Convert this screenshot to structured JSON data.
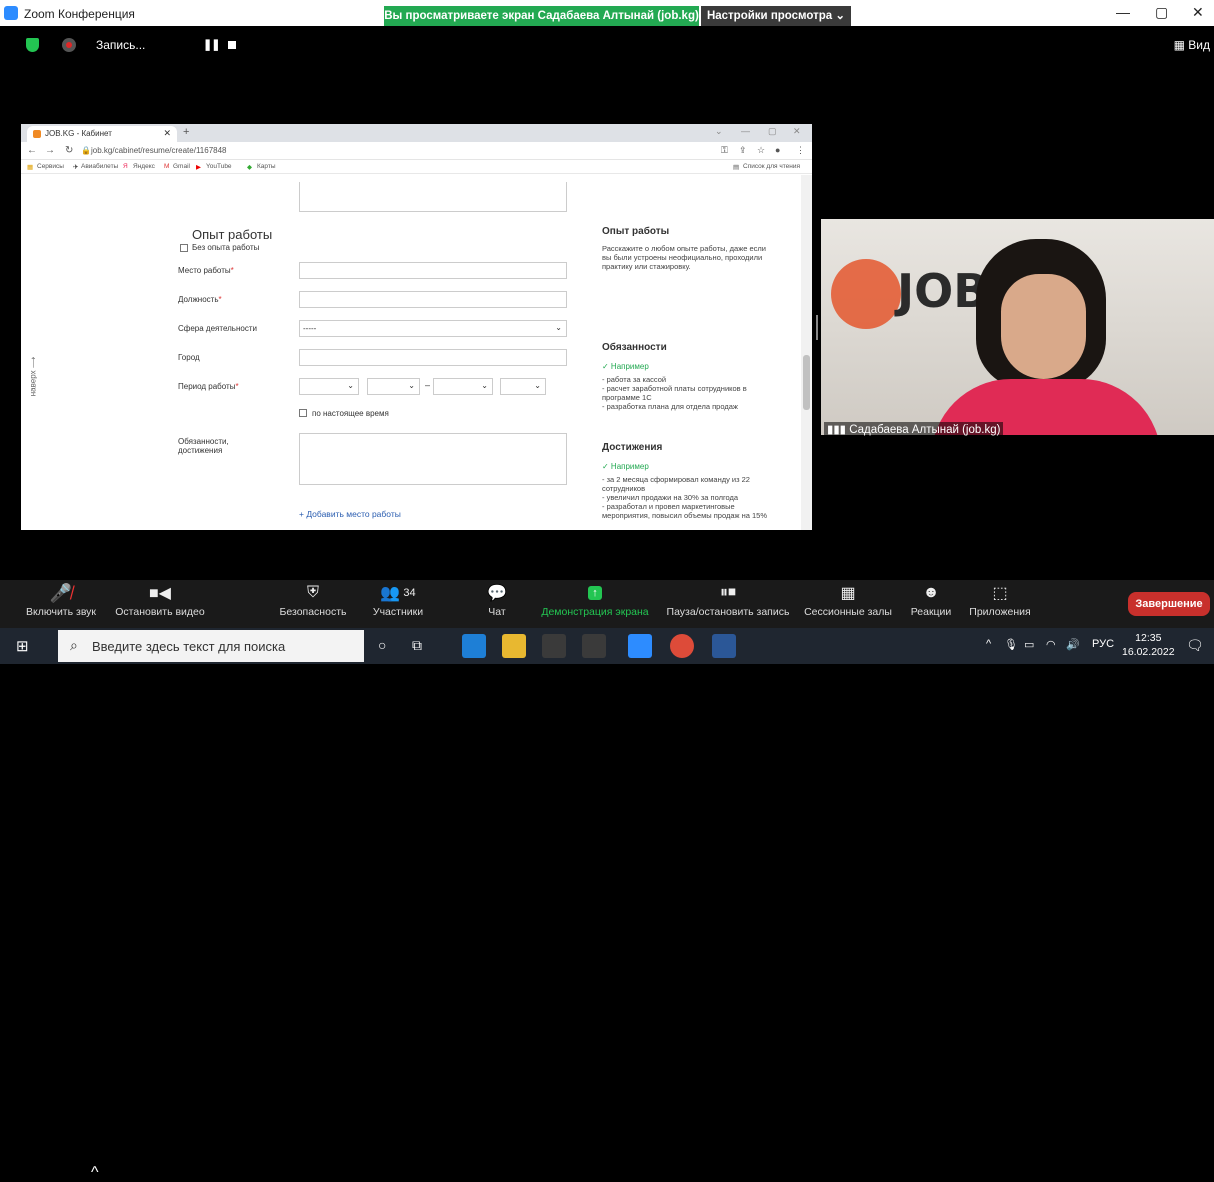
{
  "window": {
    "title": "Zoom Конференция",
    "share_banner": "Вы просматриваете экран Садабаева Алтынай (job.kg)",
    "view_settings": "Настройки просмотра ⌄",
    "minimize": "—",
    "restore": "▢",
    "close": "✕"
  },
  "recording": {
    "label": "Запись...",
    "view_label": "Вид"
  },
  "browser": {
    "tab_title": "JOB.KG - Кабинет",
    "url": "job.kg/cabinet/resume/create/1167848",
    "bookmarks": [
      "Сервисы",
      "Авиабилеты",
      "Яндекс",
      "Gmail",
      "YouTube",
      "Карты"
    ],
    "reading_list": "Список для чтения"
  },
  "form": {
    "section_title": "Опыт работы",
    "no_experience": "Без опыта работы",
    "workplace_label": "Место работы",
    "position_label": "Должность",
    "sphere_label": "Сфера деятельности",
    "sphere_value": "-----",
    "city_label": "Город",
    "period_label": "Период работы",
    "present_label": "по настоящее время",
    "duties_label": "Обязанности, достижения",
    "add_workplace": "+ Добавить место работы",
    "back_to_top": "наверх ⟶"
  },
  "sidebar_hints": {
    "exp_title": "Опыт работы",
    "exp_text": "Расскажите о любом опыте работы, даже если вы были устроены неофициально, проходили практику или стажировку.",
    "duties_title": "Обязанности",
    "example": "✓ Например",
    "duties_text": "- работа за кассой\n- расчет заработной платы сотрудников в программе 1С\n- разработка плана для отдела продаж",
    "achievements_title": "Достижения",
    "achievements_text": "- за 2 месяца сформировал команду из 22 сотрудников\n- увеличил продажи на 30% за полгода\n- разработал и провел маркетинговые мероприятия, повысил объемы продаж на 15%"
  },
  "participant": {
    "name": "Садабаева Алтынай (job.kg)"
  },
  "toolbar": {
    "unmute": "Включить звук",
    "start_video": "Остановить видео",
    "security": "Безопасность",
    "participants": "Участники",
    "participants_count": "34",
    "chat": "Чат",
    "share_screen": "Демонстрация экрана",
    "pause_record": "Пауза/остановить запись",
    "breakout": "Сессионные залы",
    "reactions": "Реакции",
    "apps": "Приложения",
    "end": "Завершение"
  },
  "taskbar": {
    "search_placeholder": "Введите здесь текст для поиска",
    "lang": "РУС",
    "time": "12:35",
    "date": "16.02.2022"
  },
  "colors": {
    "zoom_green": "#23a952",
    "end_red": "#c8302c",
    "pink_shirt": "#e02b55"
  }
}
